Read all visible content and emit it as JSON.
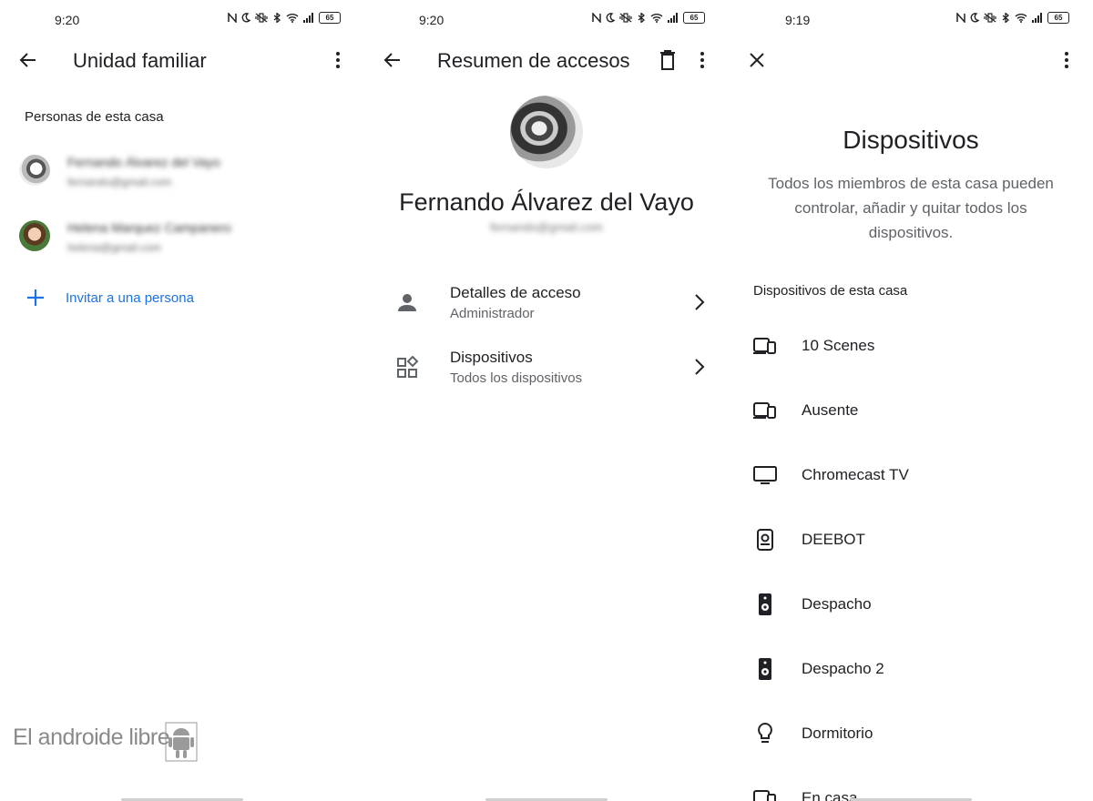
{
  "status_bars": [
    {
      "time": "9:20",
      "battery": "65"
    },
    {
      "time": "9:20",
      "battery": "65"
    },
    {
      "time": "9:19",
      "battery": "65"
    }
  ],
  "panel1": {
    "title": "Unidad familiar",
    "section_label": "Personas de esta casa",
    "people": [
      {
        "name": "Fernando Álvarez del Vayo",
        "email": "fernando@gmail.com"
      },
      {
        "name": "Helena Marquez Campanero",
        "email": "helena@gmail.com"
      }
    ],
    "invite_label": "Invitar a una persona",
    "watermark": "El androide libre"
  },
  "panel2": {
    "title": "Resumen de accesos",
    "person_name": "Fernando Álvarez del Vayo",
    "person_email": "fernando@gmail.com",
    "rows": [
      {
        "title": "Detalles de acceso",
        "subtitle": "Administrador",
        "icon": "person-icon"
      },
      {
        "title": "Dispositivos",
        "subtitle": "Todos los dispositivos",
        "icon": "widgets-icon"
      }
    ]
  },
  "panel3": {
    "title": "Dispositivos",
    "description": "Todos los miembros de esta casa pueden controlar, añadir y quitar todos los dispositivos.",
    "section_label": "Dispositivos de esta casa",
    "devices": [
      {
        "name": "10 Scenes",
        "icon": "devices-icon"
      },
      {
        "name": "Ausente",
        "icon": "devices-icon"
      },
      {
        "name": "Chromecast TV",
        "icon": "tv-icon"
      },
      {
        "name": "DEEBOT",
        "icon": "robot-vacuum-icon"
      },
      {
        "name": "Despacho",
        "icon": "speaker-icon"
      },
      {
        "name": "Despacho 2",
        "icon": "speaker-icon"
      },
      {
        "name": "Dormitorio",
        "icon": "lightbulb-icon"
      },
      {
        "name": "En casa",
        "icon": "devices-icon"
      }
    ]
  }
}
